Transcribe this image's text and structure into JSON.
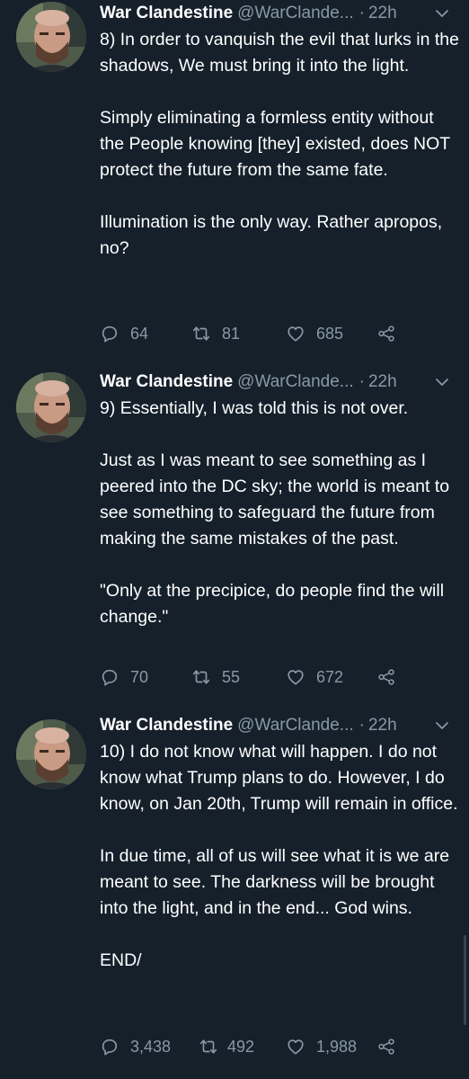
{
  "tweets": [
    {
      "name": "War Clandestine",
      "handle": "@WarClande...",
      "dot": "·",
      "time": "22h",
      "text": "8) In order to vanquish the evil that lurks in the shadows, We must bring it into the light.\n\nSimply eliminating a formless entity without the People knowing [they] existed, does NOT protect the future from the same fate.\n\nIllumination is the only way. Rather apropos, no?",
      "replies": "64",
      "retweets": "81",
      "likes": "685"
    },
    {
      "name": "War Clandestine",
      "handle": "@WarClande...",
      "dot": "·",
      "time": "22h",
      "text": "9) Essentially, I was told this is not over.\n\nJust as I was meant to see something as I peered into the DC sky; the world is meant to see something to safeguard the future from making the same mistakes of the past.\n\n\"Only at the precipice, do people find the will change.\"",
      "replies": "70",
      "retweets": "55",
      "likes": "672"
    },
    {
      "name": "War Clandestine",
      "handle": "@WarClande...",
      "dot": "·",
      "time": "22h",
      "text": "10) I do not know what will happen. I do not know what Trump plans to do. However, I do know, on Jan 20th, Trump will remain in office.\n\nIn due time, all of us will see what it is we are meant to see. The darkness will be brought into the light, and in the end... God wins.\n\nEND/",
      "replies": "3,438",
      "retweets": "492",
      "likes": "1,988"
    }
  ],
  "colors": {
    "background": "#15202b",
    "text": "#ffffff",
    "muted": "#8899a6"
  },
  "icons": [
    "reply-icon",
    "retweet-icon",
    "like-icon",
    "share-icon",
    "chevron-down-icon"
  ]
}
